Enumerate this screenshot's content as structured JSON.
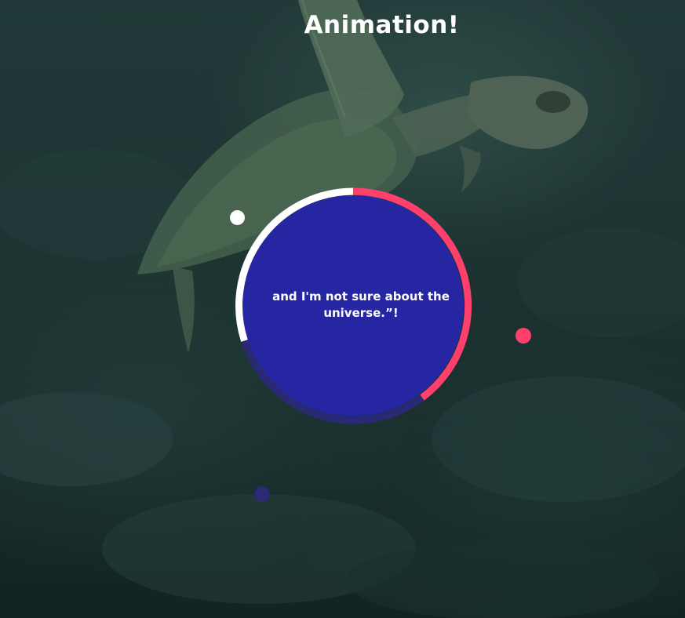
{
  "page": {
    "title": "Animation!"
  },
  "card": {
    "quote": "and I'm not sure about the universe.”!"
  },
  "colors": {
    "circle_fill": "#2626a3",
    "arc_white": "#ffffff",
    "arc_pink": "#ff3f6c",
    "arc_dark": "#2a2a74",
    "dot_white": "#ffffff",
    "dot_pink": "#ff3f6c",
    "dot_navy": "#2b2a72"
  },
  "icons": {
    "background": "sea-turtle-photo"
  }
}
